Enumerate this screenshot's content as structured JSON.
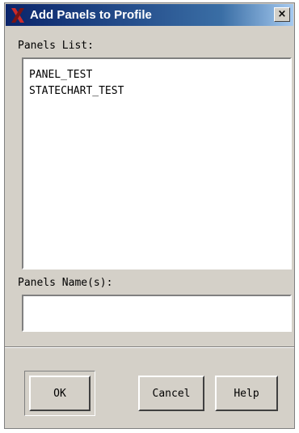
{
  "window": {
    "title": "Add Panels to Profile",
    "close_glyph": "×"
  },
  "panels_list": {
    "label": "Panels List:",
    "items": [
      "PANEL_TEST",
      "STATECHART_TEST"
    ]
  },
  "panels_name": {
    "label": "Panels Name(s):",
    "value": ""
  },
  "buttons": {
    "ok": "OK",
    "cancel": "Cancel",
    "help": "Help"
  },
  "icons": {
    "title": "x-window-icon",
    "close": "close-icon"
  },
  "colors": {
    "titlebar_start": "#0a246a",
    "titlebar_end": "#a6caf0",
    "dialog_background": "#d4d0c8",
    "icon_red": "#cc2a2a"
  }
}
